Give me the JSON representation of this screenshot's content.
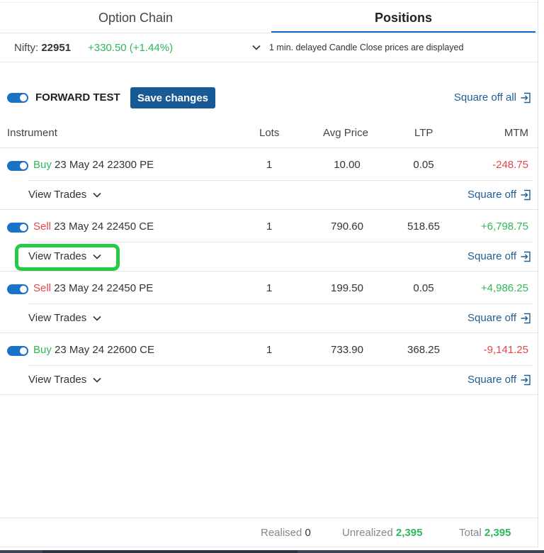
{
  "tabs": {
    "option_chain": "Option Chain",
    "positions": "Positions"
  },
  "ticker": {
    "symbol": "Nifty:",
    "price": "22951",
    "change": "+330.50 (+1.44%)",
    "note": "1 min. delayed Candle Close prices are displayed"
  },
  "controls": {
    "forward_test_label": "FORWARD TEST",
    "save_label": "Save changes",
    "square_off_all": "Square off all"
  },
  "table": {
    "headers": {
      "instrument": "Instrument",
      "lots": "Lots",
      "avg": "Avg Price",
      "ltp": "LTP",
      "mtm": "MTM"
    },
    "rows": [
      {
        "side": "Buy",
        "instrument": "23 May 24 22300 PE",
        "lots": "1",
        "avg": "10.00",
        "ltp": "0.05",
        "mtm": "-248.75",
        "view": "View Trades",
        "square": "Square off"
      },
      {
        "side": "Sell",
        "instrument": "23 May 24 22450 CE",
        "lots": "1",
        "avg": "790.60",
        "ltp": "518.65",
        "mtm": "+6,798.75",
        "view": "View Trades",
        "square": "Square off"
      },
      {
        "side": "Sell",
        "instrument": "23 May 24 22450 PE",
        "lots": "1",
        "avg": "199.50",
        "ltp": "0.05",
        "mtm": "+4,986.25",
        "view": "View Trades",
        "square": "Square off"
      },
      {
        "side": "Buy",
        "instrument": "23 May 24 22600 CE",
        "lots": "1",
        "avg": "733.90",
        "ltp": "368.25",
        "mtm": "-9,141.25",
        "view": "View Trades",
        "square": "Square off"
      }
    ]
  },
  "footer": {
    "realised_label": "Realised",
    "realised_value": "0",
    "unrealized_label": "Unrealized",
    "unrealized_value": "2,395",
    "total_label": "Total",
    "total_value": "2,395"
  },
  "colors": {
    "accent": "#175a96",
    "positive": "#2db85a",
    "negative": "#e0474c",
    "highlight": "#22cc44"
  },
  "icons": {
    "toggle": "toggle-on-icon",
    "chevron": "chevron-down-icon",
    "square_off": "exit-icon"
  }
}
